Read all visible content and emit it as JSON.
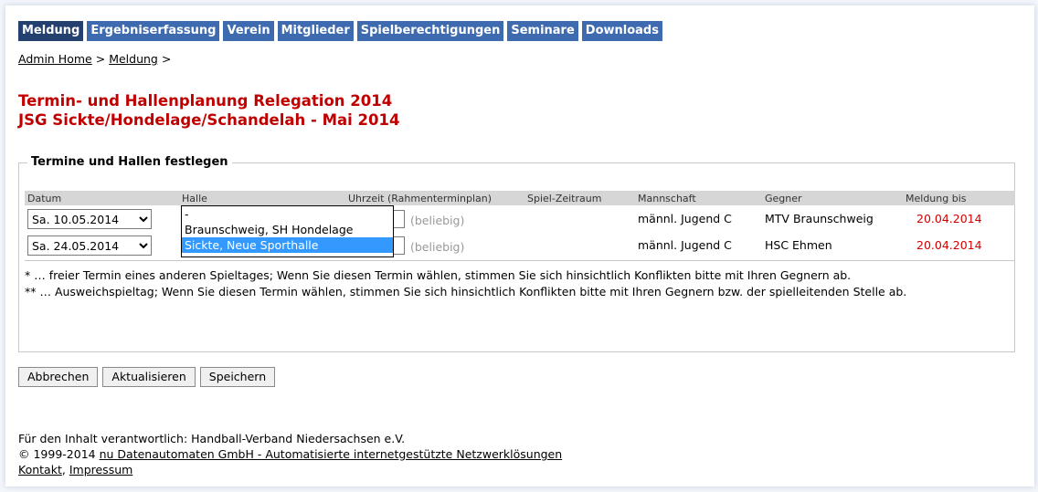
{
  "nav": {
    "tabs": [
      {
        "label": "Meldung",
        "active": true
      },
      {
        "label": "Ergebniserfassung"
      },
      {
        "label": "Verein"
      },
      {
        "label": "Mitglieder"
      },
      {
        "label": "Spielberechtigungen"
      },
      {
        "label": "Seminare"
      },
      {
        "label": "Downloads"
      }
    ]
  },
  "breadcrumb": {
    "home": "Admin Home",
    "separator": ">",
    "current": "Meldung"
  },
  "title": {
    "line1": "Termin- und Hallenplanung Relegation 2014",
    "line2": "JSG Sickte/Hondelage/Schandelah - Mai 2014"
  },
  "section": {
    "legend": "Termine und Hallen festlegen",
    "headers": {
      "datum": "Datum",
      "halle": "Halle",
      "uhrzeit": "Uhrzeit (Rahmenterminplan)",
      "zeitraum": "Spiel-Zeitraum",
      "mannschaft": "Mannschaft",
      "gegner": "Gegner",
      "meldung_bis": "Meldung bis"
    },
    "rows": [
      {
        "datum": "Sa. 10.05.2014",
        "uhrzeit": "(beliebig)",
        "mannschaft": "männl. Jugend C",
        "gegner": "MTV Braunschweig",
        "meldung_bis": "20.04.2014"
      },
      {
        "datum": "Sa. 24.05.2014",
        "uhrzeit": "(beliebig)",
        "mannschaft": "männl. Jugend C",
        "gegner": "HSC Ehmen",
        "meldung_bis": "20.04.2014"
      }
    ],
    "halle_dropdown": {
      "options": [
        "-",
        "Braunschweig, SH Hondelage",
        "Sickte, Neue Sporthalle"
      ],
      "selected_index": 2
    },
    "notes": {
      "note1": "* … freier Termin eines anderen Spieltages; Wenn Sie diesen Termin wählen, stimmen Sie sich hinsichtlich Konflikten bitte mit Ihren Gegnern ab.",
      "note2": "** … Ausweichspieltag; Wenn Sie diesen Termin wählen, stimmen Sie sich hinsichtlich Konflikten bitte mit Ihren Gegnern bzw. der spielleitenden Stelle ab."
    }
  },
  "buttons": {
    "cancel": "Abbrechen",
    "refresh": "Aktualisieren",
    "save": "Speichern"
  },
  "footer": {
    "responsible": "Für den Inhalt verantwortlich: Handball-Verband Niedersachsen e.V.",
    "copyright_prefix": "© 1999-2014",
    "copyright_link": "nu Datenautomaten GmbH - Automatisierte internetgestützte Netzwerklösungen",
    "kontakt": "Kontakt",
    "separator": ",",
    "impressum": "Impressum"
  },
  "colors": {
    "nav_bg": "#3e6bb0",
    "nav_active": "#24406f",
    "title_red": "#c00000",
    "date_red": "#d00000",
    "dropdown_highlight": "#3399ff"
  }
}
